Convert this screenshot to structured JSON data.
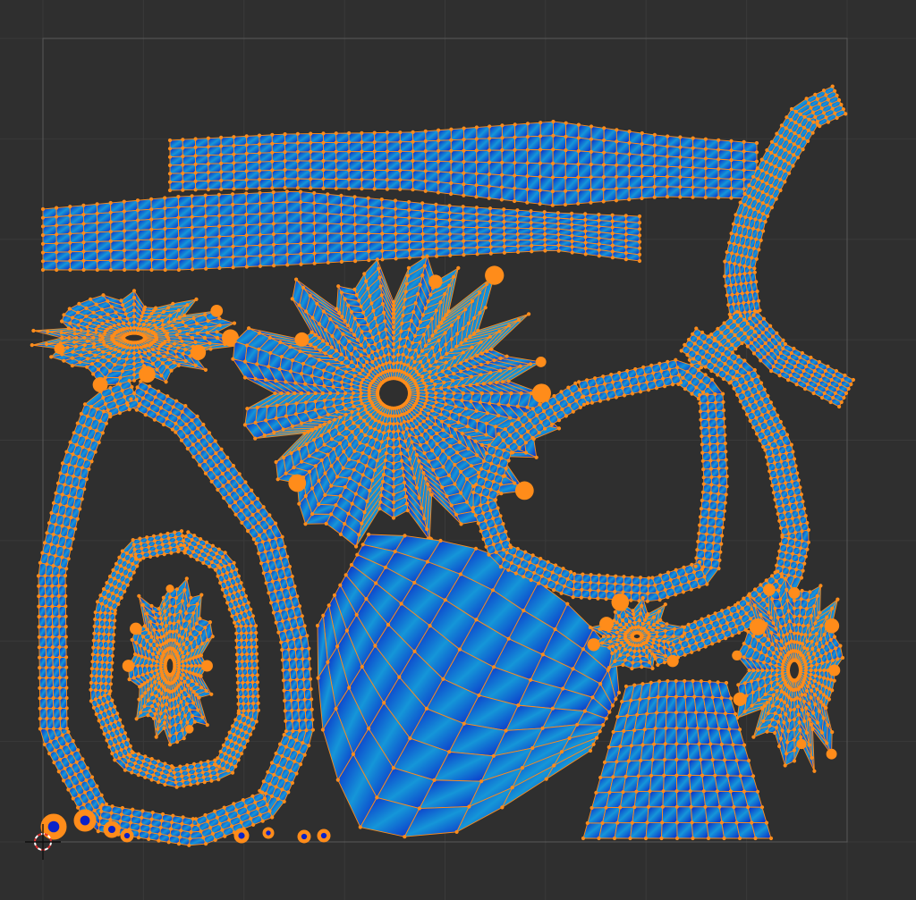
{
  "editor": {
    "type": "uv-editor",
    "background_color": "#2f2f2f",
    "grid_line_color": "#3a3a3a",
    "uv_bounds_color": "#5a5a5a",
    "island_fill_dark": "#0a22c8",
    "island_fill_light": "#1596d8",
    "edge_color": "#ff8c1a",
    "vertex_color": "#ff8c1a",
    "cursor_color_a": "#ffffff",
    "cursor_color_b": "#e03030",
    "grid_divisions": 8
  },
  "islands": [
    {
      "name": "upper-strip"
    },
    {
      "name": "lower-strip"
    },
    {
      "name": "branch-pipe"
    },
    {
      "name": "small-leaf-top-left"
    },
    {
      "name": "crumpled-sheet"
    },
    {
      "name": "outer-loop-left"
    },
    {
      "name": "inner-loop-left"
    },
    {
      "name": "leaf-core"
    },
    {
      "name": "large-fan-patch"
    },
    {
      "name": "center-loop-right"
    },
    {
      "name": "outer-loop-right"
    },
    {
      "name": "small-leaf-right"
    },
    {
      "name": "cup-patch"
    },
    {
      "name": "small-leaf-mid"
    },
    {
      "name": "bead-chain-bottom"
    }
  ]
}
